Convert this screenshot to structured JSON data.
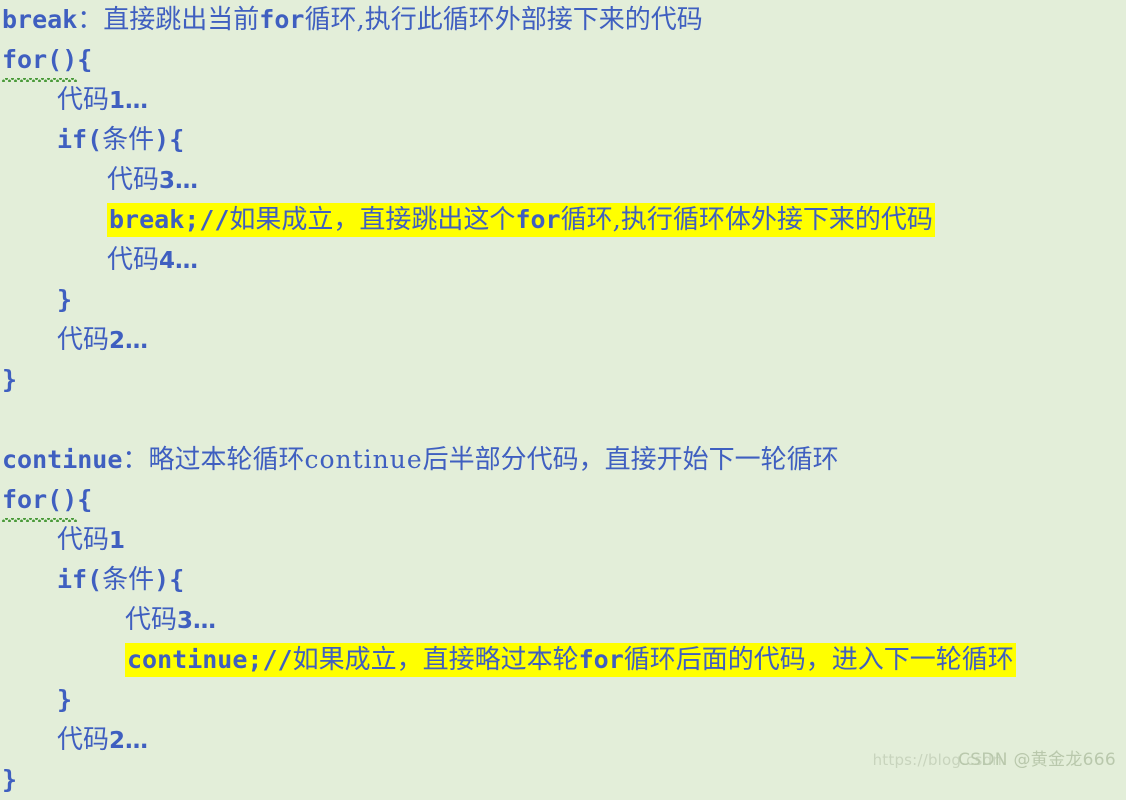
{
  "slide": {
    "background_color": "#e3eed9",
    "text_color": "#3f5fc0",
    "highlight_color": "#ffff00",
    "squiggle_color": "#4a9a3a"
  },
  "break_section": {
    "header": {
      "keyword": "break",
      "colon": "：",
      "desc_before": "直接跳出当前",
      "inline_keyword": "for",
      "desc_after": "循环,执行此循环外部接下来的代码"
    },
    "lines": {
      "for_open": "for()",
      "for_brace": "{",
      "code1": "代码",
      "code1_num": "1",
      "code1_ell": "…",
      "if_open": "if(",
      "if_cond": "条件",
      "if_close": "){",
      "code3": "代码",
      "code3_num": "3",
      "code3_ell": "…",
      "break_stmt": "break;//",
      "break_comment_a": "如果成立，直接跳出这个",
      "break_comment_kw": "for",
      "break_comment_b": "循环,执行循环体外接下来的代码",
      "code4": "代码",
      "code4_num": "4",
      "code4_ell": "…",
      "inner_close": "}",
      "code2": "代码",
      "code2_num": "2",
      "code2_ell": "…",
      "outer_close": "}"
    }
  },
  "continue_section": {
    "header": {
      "keyword": "continue",
      "colon": "：",
      "desc_before": "略过本轮循环",
      "inline_keyword": "continue",
      "desc_after": "后半部分代码，直接开始下一轮循环"
    },
    "lines": {
      "for_open": "for()",
      "for_brace": "{",
      "code1": "代码",
      "code1_num": "1",
      "if_open": "if(",
      "if_cond": "条件",
      "if_close": "){",
      "code3": "代码",
      "code3_num": "3",
      "code3_ell": "…",
      "continue_stmt": "continue;//",
      "continue_comment_a": "如果成立，直接略过本轮",
      "continue_comment_kw": "for",
      "continue_comment_b": "循环后面的代码，进入下一轮循环",
      "inner_close": "}",
      "code2": "代码",
      "code2_num": "2",
      "code2_ell": "…",
      "outer_close": "}"
    }
  },
  "watermark": {
    "url": "https://blog.csdn",
    "tag": "CSDN @黄金龙666"
  }
}
